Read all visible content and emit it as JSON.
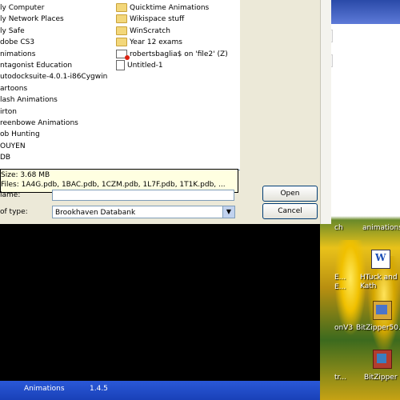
{
  "dialog": {
    "files_left": [
      {
        "label": "ly Computer",
        "icon": "computer-icon"
      },
      {
        "label": "ly Network Places",
        "icon": "network-icon"
      },
      {
        "label": "ly Safe",
        "icon": "folder-icon"
      },
      {
        "label": "dobe CS3",
        "icon": "folder-icon"
      },
      {
        "label": "nimations",
        "icon": "folder-icon"
      },
      {
        "label": "ntagonist Education",
        "icon": "folder-icon"
      },
      {
        "label": "utodocksuite-4.0.1-i86Cygwin",
        "icon": "folder-icon"
      },
      {
        "label": "artoons",
        "icon": "folder-icon"
      },
      {
        "label": "lash Animations",
        "icon": "folder-icon"
      },
      {
        "label": "irton",
        "icon": "folder-icon"
      },
      {
        "label": "reenbowe Animations",
        "icon": "folder-icon"
      },
      {
        "label": "ob Hunting",
        "icon": "folder-icon"
      },
      {
        "label": "OUYEN",
        "icon": "folder-icon"
      },
      {
        "label": "DB",
        "icon": "folder-icon"
      }
    ],
    "files_right": [
      {
        "label": "Quicktime Animations",
        "icon": "folder-icon"
      },
      {
        "label": "Wikispace stuff",
        "icon": "folder-icon"
      },
      {
        "label": "WinScratch",
        "icon": "folder-icon"
      },
      {
        "label": "Year 12 exams",
        "icon": "folder-icon"
      },
      {
        "label": "robertsbaglia$ on 'file2' (Z)",
        "icon": "network-drive-icon"
      },
      {
        "label": "Untitled-1",
        "icon": "document-icon"
      }
    ],
    "tooltip": {
      "size_line": "Size: 3.68 MB",
      "files_line": "Files: 1A4G.pdb, 1BAC.pdb, 1CZM.pdb, 1L7F.pdb, 1T1K.pdb, ..."
    },
    "name_label": "lame:",
    "name_value": "",
    "type_label": "of type:",
    "type_value": "Brookhaven Databank",
    "open_button": "Open",
    "cancel_button": "Cancel"
  },
  "taskbar": {
    "item1": "Animations",
    "item2": "1.4.5"
  },
  "desktop": {
    "top_label": "ch",
    "top_label2": "animations",
    "word_label": "HTuck and\nKath",
    "label_e": "E...",
    "label_e2": "E...",
    "label_onv3": "onV3",
    "bitzipper_label": "BitZipper50...",
    "tr_label": "tr...",
    "bitzipper2_label": "BitZipper"
  }
}
